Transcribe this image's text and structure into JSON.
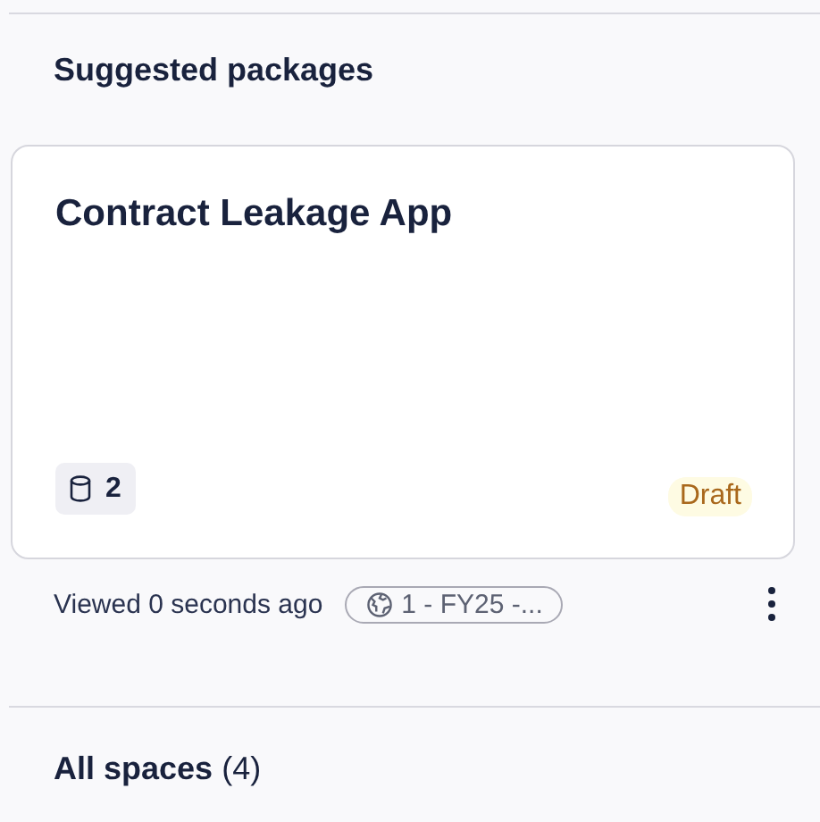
{
  "section_title": "Suggested packages",
  "package": {
    "title": "Contract Leakage App",
    "datasets_count": "2",
    "status": "Draft",
    "viewed": "Viewed 0 seconds ago",
    "space": "1 - FY25 -..."
  },
  "all_spaces": {
    "label": "All spaces",
    "count": "(4)"
  }
}
